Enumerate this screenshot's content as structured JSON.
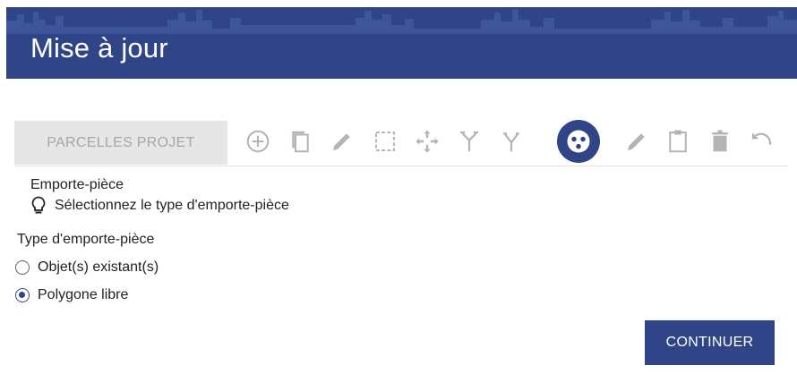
{
  "header": {
    "title": "Mise à jour"
  },
  "toolbar": {
    "layer_tab": "PARCELLES PROJET",
    "tools": [
      {
        "icon": "add-circle-icon"
      },
      {
        "icon": "copy-icon"
      },
      {
        "icon": "pencil-icon"
      },
      {
        "icon": "select-box-icon"
      },
      {
        "icon": "move-icon"
      },
      {
        "icon": "merge-icon"
      },
      {
        "icon": "split-icon"
      },
      {
        "icon": "cookie-cutter-icon",
        "active": true
      },
      {
        "icon": "pencil-icon"
      },
      {
        "icon": "clipboard-icon"
      },
      {
        "icon": "trash-icon"
      },
      {
        "icon": "undo-icon"
      }
    ]
  },
  "panel": {
    "section_title": "Emporte-pièce",
    "hint": "Sélectionnez le type d'emporte-pièce",
    "group_label": "Type d'emporte-pièce",
    "options": [
      {
        "label": "Objet(s) existant(s)",
        "checked": false
      },
      {
        "label": "Polygone libre",
        "checked": true
      }
    ]
  },
  "actions": {
    "continue_label": "CONTINUER"
  },
  "colors": {
    "primary": "#2f4588",
    "tab_bg": "#e6e6e6",
    "tab_text": "#a6a6a6",
    "icon": "#b4b4b4"
  }
}
